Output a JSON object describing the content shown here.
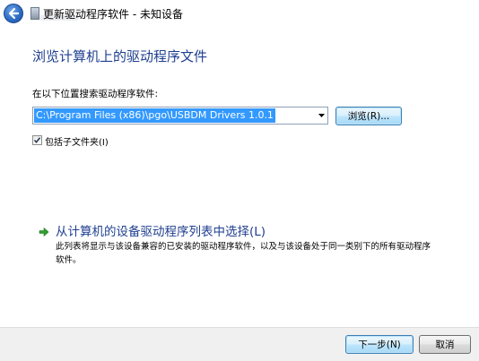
{
  "window": {
    "title": "更新驱动程序软件 - 未知设备"
  },
  "heading": "浏览计算机上的驱动程序文件",
  "path_section": {
    "label": "在以下位置搜索驱动程序软件:",
    "value": "C:\\Program Files (x86)\\pgo\\USBDM Drivers 1.0.1",
    "browse_label": "浏览(R)..."
  },
  "include_subfolders": {
    "label": "包括子文件夹(I)",
    "checked": true
  },
  "command_link": {
    "title": "从计算机的设备驱动程序列表中选择(L)",
    "description": "此列表将显示与该设备兼容的已安装的驱动程序软件，以及与该设备处于同一类别下的所有驱动程序软件。"
  },
  "footer": {
    "next_label": "下一步(N)",
    "cancel_label": "取消"
  },
  "colors": {
    "heading": "#1f3f8f",
    "selection": "#3399ff",
    "arrow": "#2e9e2e"
  },
  "icons": {
    "back": "back-arrow-icon",
    "title": "driver-icon",
    "dropdown": "chevron-down-icon",
    "command": "green-arrow-icon"
  }
}
